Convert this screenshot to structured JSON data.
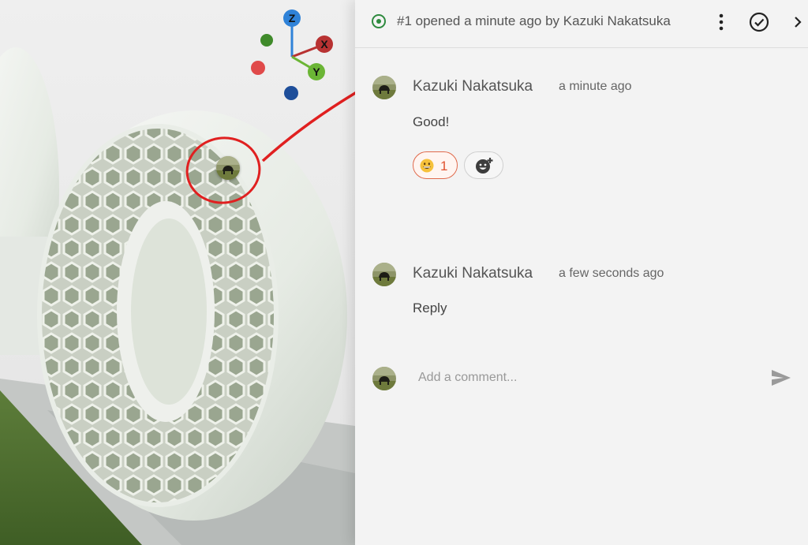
{
  "viewport": {
    "axes": {
      "z": "Z",
      "x": "X",
      "y": "Y"
    },
    "colors": {
      "z": "#2f82d8",
      "x": "#b83232",
      "y": "#6bb535",
      "neg_x": "#e04a4a",
      "neg_y": "#3f8a2a",
      "neg_z": "#1e4e9a",
      "annotation": "#e02020"
    }
  },
  "header": {
    "title": "#1 opened a minute ago by Kazuki Nakatsuka",
    "status_icon": "open-circle-icon",
    "status_color": "#2e8a3e"
  },
  "comments": [
    {
      "author": "Kazuki Nakatsuka",
      "time": "a minute ago",
      "body": "Good!",
      "reactions": [
        {
          "emoji": "grinning-face-icon",
          "count": "1"
        }
      ]
    },
    {
      "author": "Kazuki Nakatsuka",
      "time": "a few seconds ago",
      "body": "Reply"
    }
  ],
  "composer": {
    "placeholder": "Add a comment...",
    "send_icon": "send-icon"
  }
}
